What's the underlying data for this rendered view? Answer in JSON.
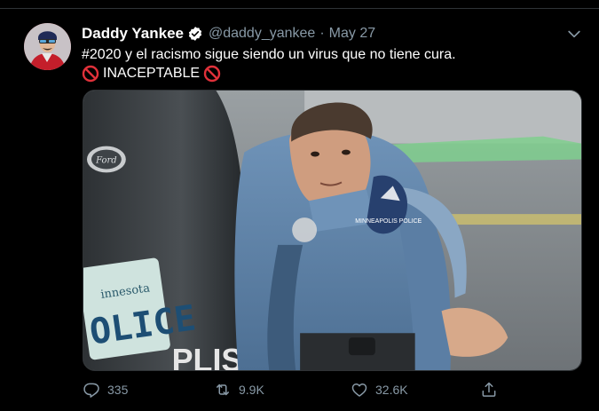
{
  "tweet": {
    "author": {
      "display_name": "Daddy Yankee",
      "verified": true,
      "handle": "@daddy_yankee",
      "avatar_icon": "avatar-photo"
    },
    "separator": "·",
    "date": "May 27",
    "text_line1": "#2020 y el racismo sigue siendo un virus que no tiene cura.",
    "text_line2": "INACEPTABLE",
    "emoji": "no-entry-icon",
    "media": {
      "type": "photo",
      "plate_text_state": "innesota",
      "plate_text_main": "OLICE",
      "bumper_text": "PLIS",
      "patch_text": "MINNEAPOLIS POLICE"
    },
    "actions": {
      "reply_count": "335",
      "retweet_count": "9.9K",
      "like_count": "32.6K"
    }
  },
  "colors": {
    "background": "#000000",
    "text_primary": "#ffffff",
    "text_secondary": "#8899a6",
    "verified": "#1da1f2",
    "no_entry": "#e0313a"
  }
}
